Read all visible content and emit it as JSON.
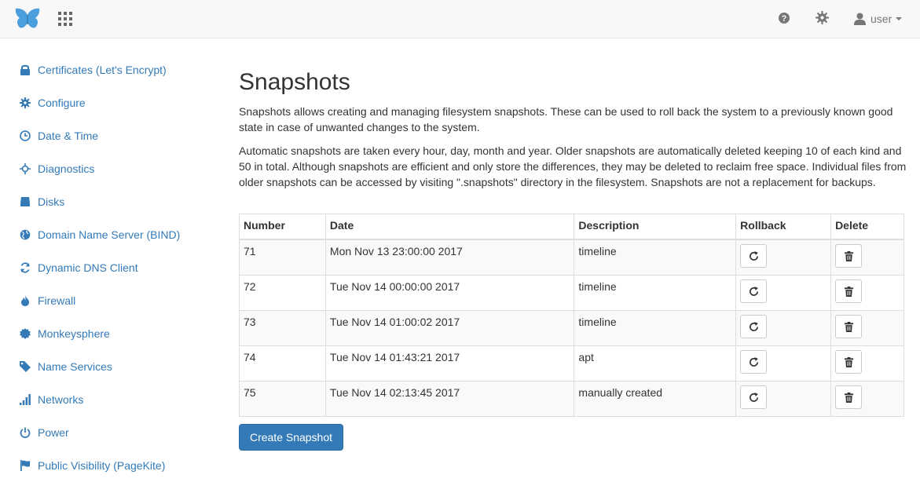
{
  "navbar": {
    "brand_icon": "butterfly-logo",
    "apps_icon": "grid-icon",
    "help_icon": "question-circle-icon",
    "settings_icon": "gear-icon",
    "user_label": "user",
    "brand_color": "#4a9fdc"
  },
  "sidebar": {
    "items": [
      {
        "label": "Certificates (Let's Encrypt)",
        "icon": "lock-icon"
      },
      {
        "label": "Configure",
        "icon": "cog-icon"
      },
      {
        "label": "Date & Time",
        "icon": "clock-icon"
      },
      {
        "label": "Diagnostics",
        "icon": "screenshot-icon"
      },
      {
        "label": "Disks",
        "icon": "hdd-icon"
      },
      {
        "label": "Domain Name Server (BIND)",
        "icon": "globe-icon"
      },
      {
        "label": "Dynamic DNS Client",
        "icon": "refresh-icon"
      },
      {
        "label": "Firewall",
        "icon": "fire-icon"
      },
      {
        "label": "Monkeysphere",
        "icon": "certificate-icon"
      },
      {
        "label": "Name Services",
        "icon": "tag-icon"
      },
      {
        "label": "Networks",
        "icon": "signal-icon"
      },
      {
        "label": "Power",
        "icon": "off-icon"
      },
      {
        "label": "Public Visibility (PageKite)",
        "icon": "flag-icon"
      }
    ]
  },
  "main": {
    "title": "Snapshots",
    "paragraph1": "Snapshots allows creating and managing filesystem snapshots. These can be used to roll back the system to a previously known good state in case of unwanted changes to the system.",
    "paragraph2": "Automatic snapshots are taken every hour, day, month and year. Older snapshots are automatically deleted keeping 10 of each kind and 50 in total. Although snapshots are efficient and only store the differences, they may be deleted to reclaim free space. Individual files from older snapshots can be accessed by visiting \".snapshots\" directory in the filesystem. Snapshots are not a replacement for backups.",
    "table": {
      "headers": {
        "number": "Number",
        "date": "Date",
        "description": "Description",
        "rollback": "Rollback",
        "delete": "Delete"
      },
      "rows": [
        {
          "number": "71",
          "date": "Mon Nov 13 23:00:00 2017",
          "description": "timeline"
        },
        {
          "number": "72",
          "date": "Tue Nov 14 00:00:00 2017",
          "description": "timeline"
        },
        {
          "number": "73",
          "date": "Tue Nov 14 01:00:02 2017",
          "description": "timeline"
        },
        {
          "number": "74",
          "date": "Tue Nov 14 01:43:21 2017",
          "description": "apt"
        },
        {
          "number": "75",
          "date": "Tue Nov 14 02:13:45 2017",
          "description": "manually created"
        }
      ],
      "rollback_icon": "refresh-icon",
      "delete_icon": "trash-icon"
    },
    "create_button": "Create Snapshot",
    "primary_color": "#337ab7",
    "link_color": "#337ab7"
  }
}
